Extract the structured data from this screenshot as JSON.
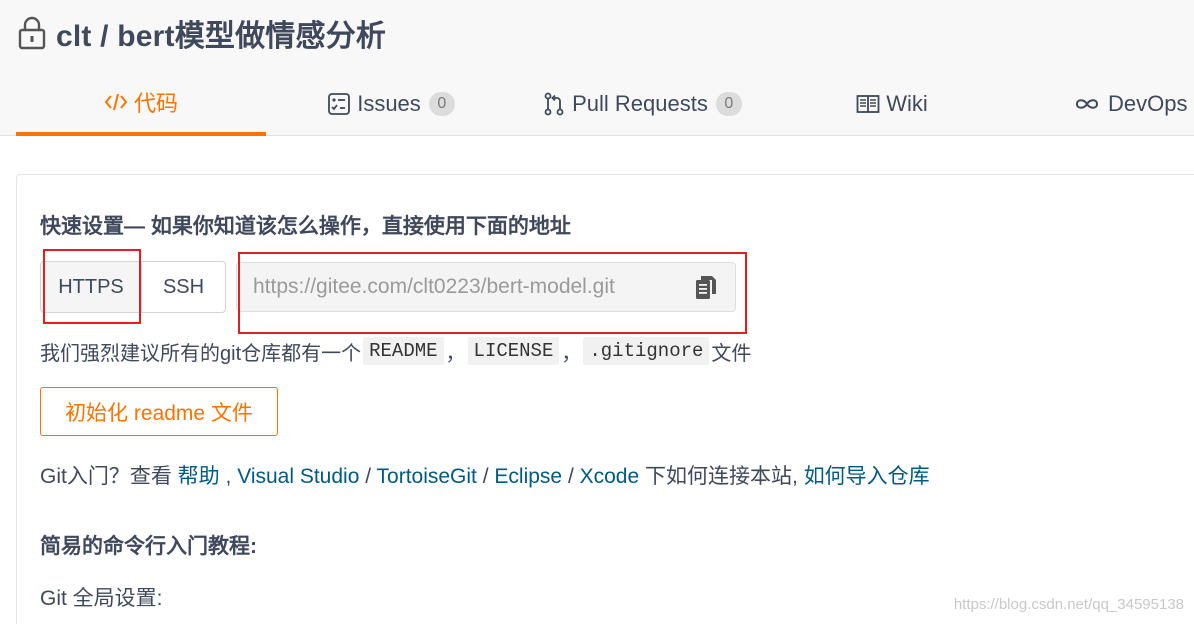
{
  "repo": {
    "title": "clt / bert模型做情感分析",
    "icon": "lock-icon"
  },
  "tabs": [
    {
      "label": "代码",
      "icon": "code-icon",
      "active": true
    },
    {
      "label": "Issues",
      "icon": "issues-icon",
      "count": "0"
    },
    {
      "label": "Pull Requests",
      "icon": "pull-request-icon",
      "count": "0"
    },
    {
      "label": "Wiki",
      "icon": "book-icon"
    },
    {
      "label": "DevOps",
      "icon": "infinity-icon"
    }
  ],
  "quick_setup": {
    "title": "快速设置— 如果你知道该怎么操作，直接使用下面的地址",
    "protocols": [
      "HTTPS",
      "SSH"
    ],
    "selected_protocol": "HTTPS",
    "url": "https://gitee.com/clt0223/bert-model.git"
  },
  "recommend": {
    "prefix": "我们强烈建议所有的git仓库都有一个",
    "files": [
      "README",
      "LICENSE",
      ".gitignore"
    ],
    "sep": "，",
    "suffix": "文件"
  },
  "init_button": "初始化 readme 文件",
  "guide": {
    "prefix": "Git入门？查看 ",
    "links": [
      "帮助",
      "Visual Studio",
      "TortoiseGit",
      "Eclipse",
      "Xcode"
    ],
    "middle": " 下如何连接本站, ",
    "import_link": "如何导入仓库"
  },
  "tutorial_title": "简易的命令行入门教程:",
  "git_global": "Git 全局设置:",
  "watermark": "https://blog.csdn.net/qq_34595138",
  "colors": {
    "accent": "#fe7300",
    "link": "#005980",
    "highlight": "#e0201f"
  }
}
